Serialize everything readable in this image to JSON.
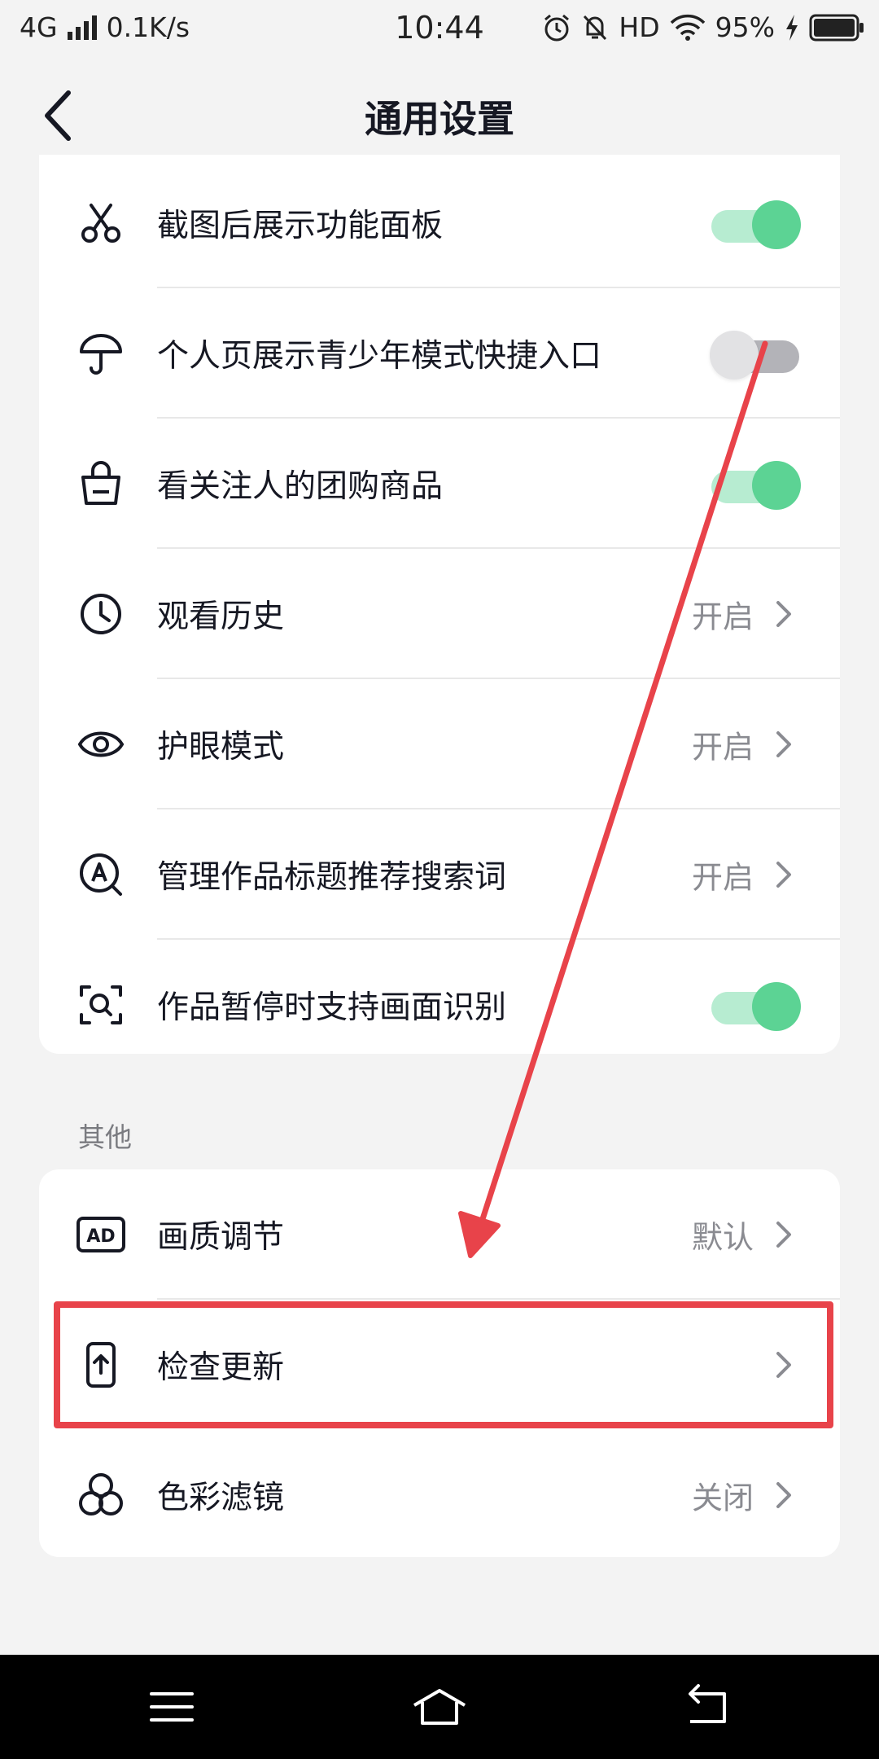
{
  "status_bar": {
    "network": "4G",
    "speed": "0.1K/s",
    "time": "10:44",
    "hd": "HD",
    "battery": "95%"
  },
  "header": {
    "title": "通用设置"
  },
  "settings": [
    {
      "label": "截图后展示功能面板",
      "icon": "scissors-icon",
      "type": "toggle",
      "on": true
    },
    {
      "label": "个人页展示青少年模式快捷入口",
      "icon": "umbrella-icon",
      "type": "toggle",
      "on": false
    },
    {
      "label": "看关注人的团购商品",
      "icon": "shopping-bag-icon",
      "type": "toggle",
      "on": true
    },
    {
      "label": "观看历史",
      "icon": "clock-icon",
      "type": "link",
      "value": "开启"
    },
    {
      "label": "护眼模式",
      "icon": "eye-icon",
      "type": "link",
      "value": "开启"
    },
    {
      "label": "管理作品标题推荐搜索词",
      "icon": "search-a-icon",
      "type": "link",
      "value": "开启"
    },
    {
      "label": "作品暂停时支持画面识别",
      "icon": "scan-icon",
      "type": "toggle",
      "on": true
    }
  ],
  "other_section": {
    "title": "其他",
    "items": [
      {
        "label": "画质调节",
        "icon": "ad-icon",
        "value": "默认"
      },
      {
        "label": "检查更新",
        "icon": "phone-upload-icon",
        "value": ""
      },
      {
        "label": "色彩滤镜",
        "icon": "color-circles-icon",
        "value": "关闭"
      }
    ]
  },
  "annotation": {
    "arrow_color": "#e8434a",
    "box_color": "#e8434a"
  },
  "colors": {
    "toggle_on": "#5cd394",
    "toggle_off": "#b3b3b8",
    "background": "#f3f3f3"
  }
}
